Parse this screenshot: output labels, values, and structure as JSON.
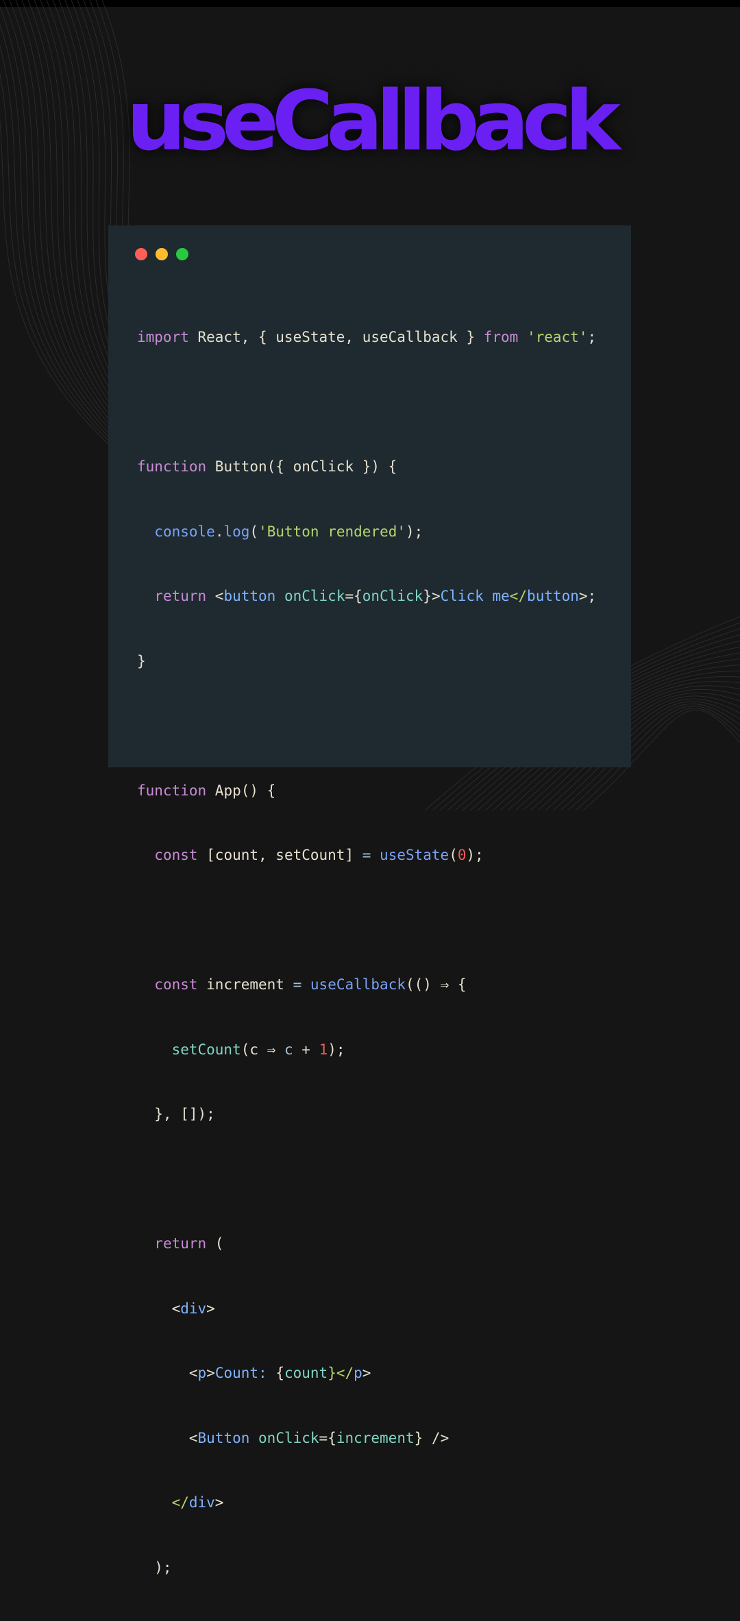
{
  "title": "useCallback",
  "colors": {
    "title": "#6a20f2",
    "card_background": "#1f2a30",
    "dot_red": "#ff5f56",
    "dot_yellow": "#ffbd2e",
    "dot_green": "#27c93f"
  },
  "window_controls": [
    "red-dot",
    "yellow-dot",
    "green-dot"
  ],
  "code": {
    "l1": {
      "a": "import",
      "b": " React, { useState, useCallback } ",
      "c": "from",
      "d": " ",
      "e": "'react'",
      "f": ";"
    },
    "l3": {
      "a": "function",
      "b": " Button({ onClick }) {"
    },
    "l4": {
      "a": "  ",
      "b": "console",
      "c": ".",
      "d": "log",
      "e": "(",
      "f": "'Button rendered'",
      "g": ");"
    },
    "l5": {
      "a": "  ",
      "b": "return",
      "c": " <",
      "d": "button",
      "e": " ",
      "f": "onClick",
      "g": "={",
      "h": "onClick",
      "i": "}>",
      "j": "Click me",
      "k": "</",
      "l": "button",
      "m": ">;"
    },
    "l6": {
      "a": "}"
    },
    "l8": {
      "a": "function",
      "b": " App() {"
    },
    "l9": {
      "a": "  ",
      "b": "const",
      "c": " [count, setCount] ",
      "d": "=",
      "e": " ",
      "f": "useState",
      "g": "(",
      "h": "0",
      "i": ");"
    },
    "l11": {
      "a": "  ",
      "b": "const",
      "c": " increment ",
      "d": "=",
      "e": " ",
      "f": "useCallback",
      "g": "(() ",
      "h": "⇒",
      "i": " {"
    },
    "l12": {
      "a": "    ",
      "b": "setCount",
      "c": "(c ",
      "d": "⇒",
      "e": " ",
      "f": "c",
      "g": " + ",
      "h": "1",
      "i": ");"
    },
    "l13": {
      "a": "  }, []);"
    },
    "l15": {
      "a": "  ",
      "b": "return",
      "c": " ("
    },
    "l16": {
      "a": "    <",
      "b": "div",
      "c": ">"
    },
    "l17": {
      "a": "      <",
      "b": "p",
      "c": ">",
      "d": "Count:",
      "e": " {",
      "f": "count",
      "g": "}</",
      "h": "p",
      "i": ">"
    },
    "l18": {
      "a": "      <",
      "b": "Button",
      "c": " ",
      "d": "onClick",
      "e": "={",
      "f": "increment",
      "g": "} />"
    },
    "l19": {
      "a": "    </",
      "b": "div",
      "c": ">"
    },
    "l20": {
      "a": "  );"
    },
    "l21": {
      "a": "}"
    }
  }
}
